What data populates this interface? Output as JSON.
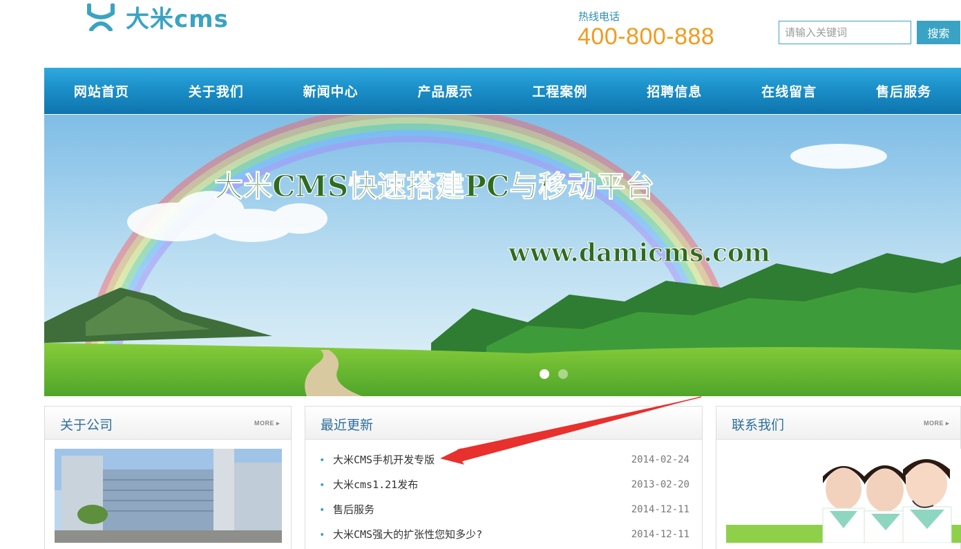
{
  "header": {
    "logo_text": "大米cms",
    "hotline_label": "热线电话",
    "hotline_number": "400-800-888",
    "search_placeholder": "请输入关键词",
    "search_button": "搜索"
  },
  "nav": {
    "items": [
      "网站首页",
      "关于我们",
      "新闻中心",
      "产品展示",
      "工程案例",
      "招聘信息",
      "在线留言",
      "售后服务"
    ]
  },
  "banner": {
    "headline": "大米CMS快速搭建PC与移动平台",
    "url": "www.damicms.com",
    "slide_count": 2,
    "active_slide": 1
  },
  "panels": {
    "about": {
      "title": "关于公司",
      "more": "MORE ▸"
    },
    "news": {
      "title": "最近更新",
      "items": [
        {
          "title": "大米CMS手机开发专版",
          "date": "2014-02-24"
        },
        {
          "title": "大米cms1.21发布",
          "date": "2013-02-20"
        },
        {
          "title": "售后服务",
          "date": "2014-12-11"
        },
        {
          "title": "大米CMS强大的扩张性您知多少?",
          "date": "2014-12-11"
        }
      ]
    },
    "contact": {
      "title": "联系我们",
      "more": "MORE ▸"
    }
  },
  "colors": {
    "brand": "#3aa3c4",
    "hotline": "#f39a1e",
    "nav": "#1b8fc8",
    "annotation_arrow": "#e8302c"
  }
}
